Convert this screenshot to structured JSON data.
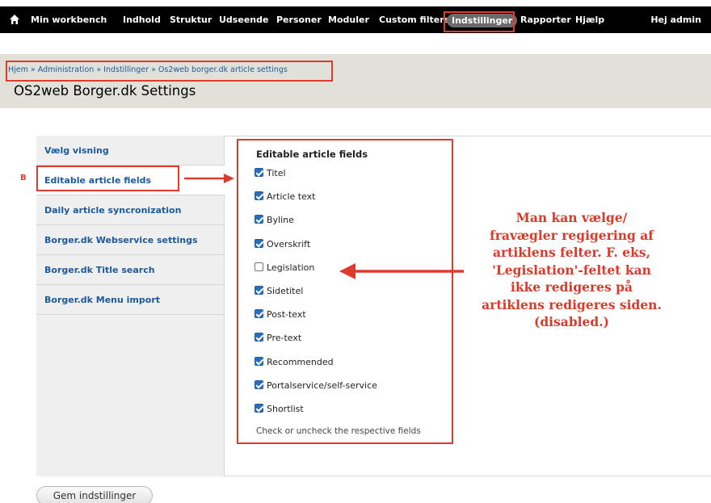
{
  "toolbar": {
    "items": [
      "Min workbench",
      "Indhold",
      "Struktur",
      "Udseende",
      "Personer",
      "Moduler",
      "Custom filters",
      "Indstillinger",
      "Rapporter",
      "Hjælp"
    ],
    "greeting_prefix": "Hej",
    "user": "admin"
  },
  "breadcrumb": [
    "Hjem",
    "Administration",
    "Indstillinger",
    "Os2web borger.dk article settings"
  ],
  "breadcrumb_sep": "»",
  "page_title": "OS2web Borger.dk Settings",
  "tabs": [
    "Vælg visning",
    "Editable article fields",
    "Daily article syncronization",
    "Borger.dk Webservice settings",
    "Borger.dk Title search",
    "Borger.dk Menu import"
  ],
  "active_tab": "Editable article fields",
  "fieldset": {
    "legend": "Editable article fields",
    "fields": [
      {
        "label": "Titel",
        "checked": true
      },
      {
        "label": "Article text",
        "checked": true
      },
      {
        "label": "Byline",
        "checked": true
      },
      {
        "label": "Overskrift",
        "checked": true
      },
      {
        "label": "Legislation",
        "checked": false
      },
      {
        "label": "Sidetitel",
        "checked": true
      },
      {
        "label": "Post-text",
        "checked": true
      },
      {
        "label": "Pre-text",
        "checked": true
      },
      {
        "label": "Recommended",
        "checked": true
      },
      {
        "label": "Portalservice/self-service",
        "checked": true
      },
      {
        "label": "Shortlist",
        "checked": true
      }
    ],
    "help": "Check or uncheck the respective fields"
  },
  "annotation": {
    "marker": "B",
    "lines": [
      "Man kan vælge/",
      "fravægler regigering af",
      "artiklens felter. F. eks,",
      "'Legislation'-feltet kan",
      "ikke redigeres på",
      "artiklens redigeres siden.",
      "(disabled.)"
    ]
  },
  "save_button": "Gem indstillinger",
  "colors": {
    "annotation_red": "#e03a2c",
    "link_blue": "#1b5a9c",
    "checkbox_blue": "#2a6ebb"
  }
}
